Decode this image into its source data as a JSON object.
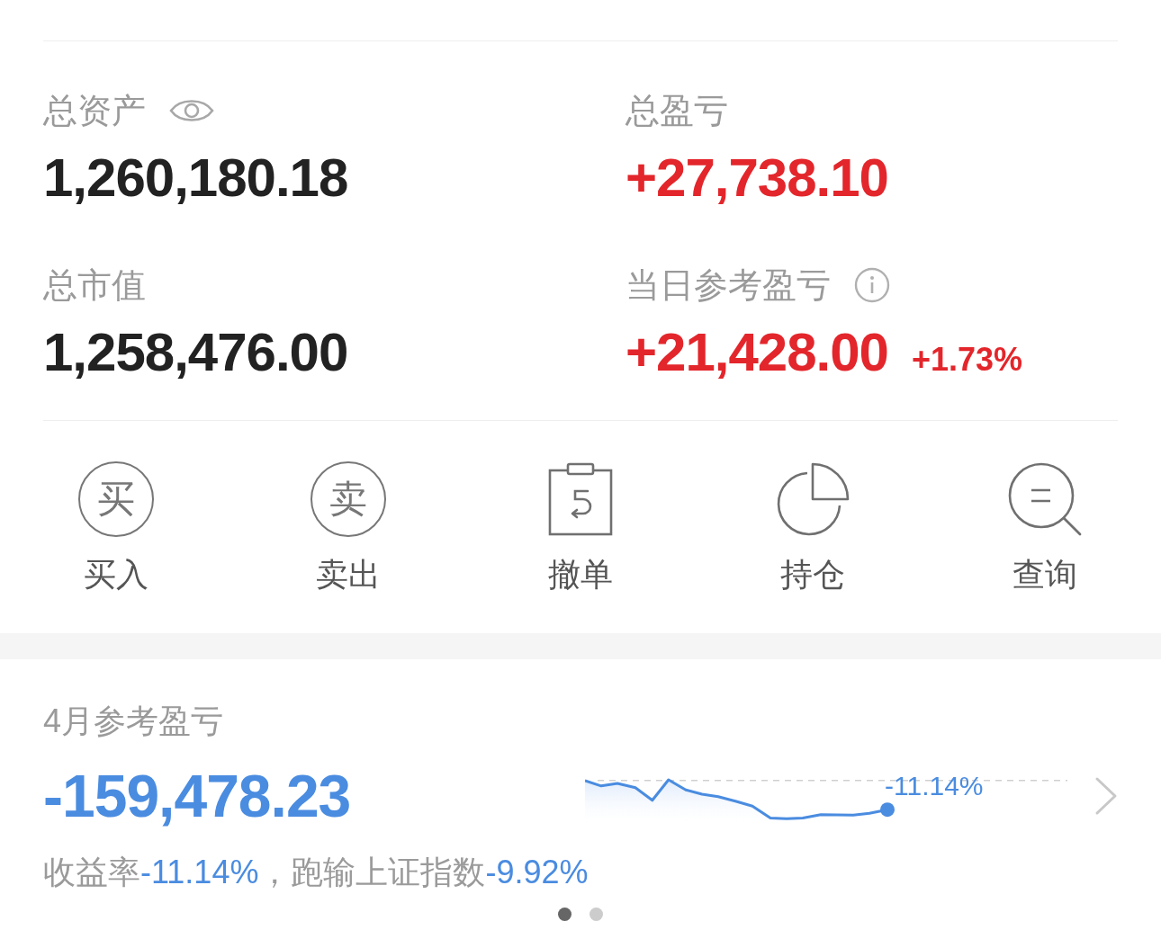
{
  "summary": {
    "stats": [
      {
        "kind": "asset",
        "label": "总资产",
        "value": "1,260,180.18",
        "color": "#222222"
      },
      {
        "kind": "pnl",
        "label": "总盈亏",
        "value": "+27,738.10",
        "color": "#e3262b"
      },
      {
        "kind": "market_value",
        "label": "总市值",
        "value": "1,258,476.00",
        "color": "#222222"
      },
      {
        "kind": "daily_pnl",
        "label": "当日参考盈亏",
        "value": "+21,428.00",
        "change": "+1.73%",
        "color": "#e3262b"
      }
    ]
  },
  "actions": [
    {
      "kind": "buy",
      "glyph": "买",
      "label": "买入"
    },
    {
      "kind": "sell",
      "glyph": "卖",
      "label": "卖出"
    },
    {
      "kind": "cancel",
      "label": "撤单"
    },
    {
      "kind": "holdings",
      "label": "持仓"
    },
    {
      "kind": "query",
      "label": "查询"
    }
  ],
  "monthly": {
    "label": "4月参考盈亏",
    "value": "-159,478.23",
    "color": "#4a8ce0",
    "sparkline_label": "-11.14%",
    "summary": [
      {
        "kind": "label",
        "text": "收益率"
      },
      {
        "kind": "value",
        "text": "-11.14%"
      },
      {
        "kind": "label",
        "text": "，跑输上证指数"
      },
      {
        "kind": "value",
        "text": "-9.92%"
      }
    ]
  },
  "pager": [
    {
      "selected": true
    },
    {
      "selected": false
    }
  ]
}
